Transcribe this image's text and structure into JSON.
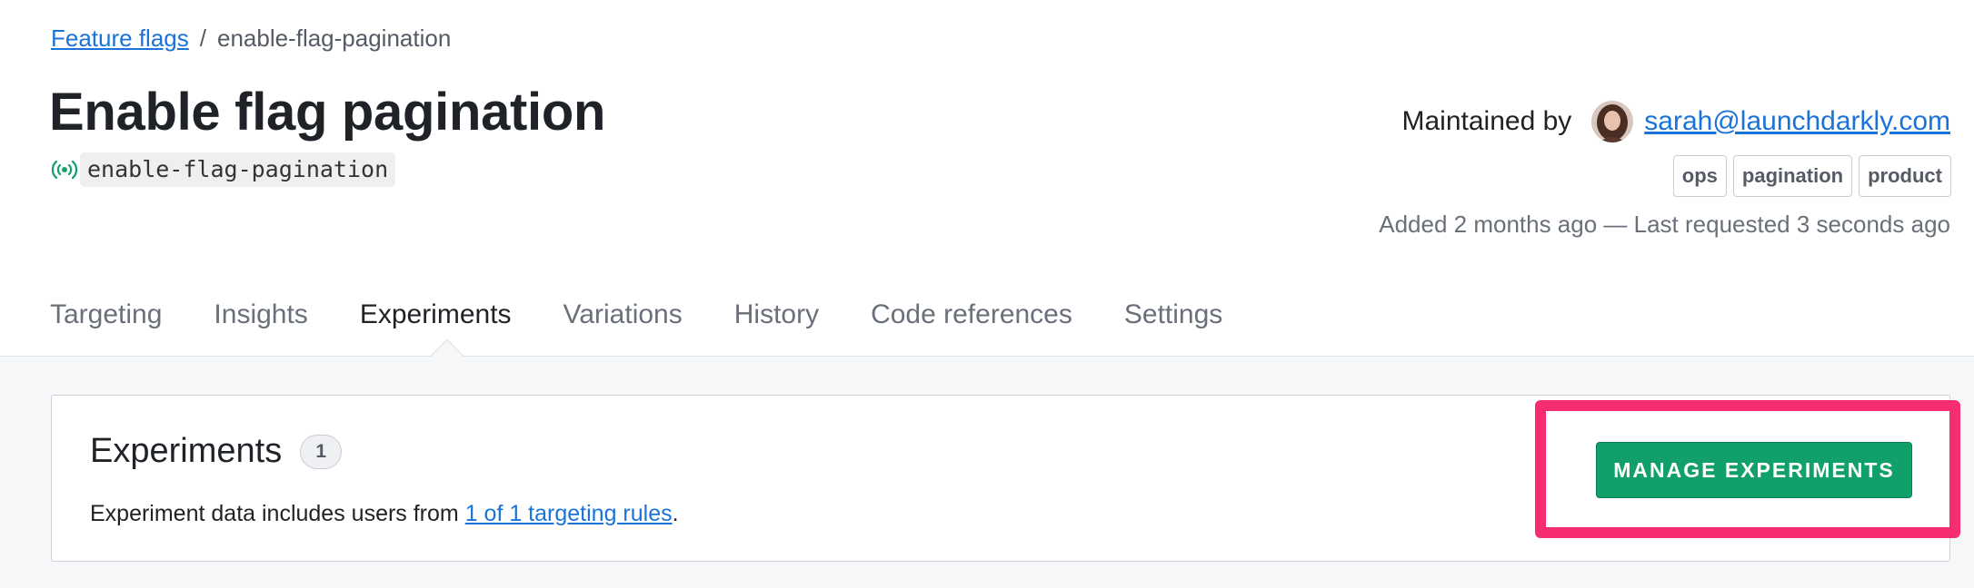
{
  "breadcrumb": {
    "parent": "Feature flags",
    "separator": "/",
    "current": "enable-flag-pagination"
  },
  "flag": {
    "name": "Enable flag pagination",
    "key": "enable-flag-pagination",
    "status_icon": "signal-broadcast-icon"
  },
  "maintainer": {
    "label": "Maintained by",
    "email": "sarah@launchdarkly.com"
  },
  "tags": [
    "ops",
    "pagination",
    "product"
  ],
  "dates_text": "Added 2 months ago — Last requested 3 seconds ago",
  "tabs": [
    {
      "label": "Targeting",
      "active": false
    },
    {
      "label": "Insights",
      "active": false
    },
    {
      "label": "Experiments",
      "active": true
    },
    {
      "label": "Variations",
      "active": false
    },
    {
      "label": "History",
      "active": false
    },
    {
      "label": "Code references",
      "active": false
    },
    {
      "label": "Settings",
      "active": false
    }
  ],
  "experiments": {
    "title": "Experiments",
    "count": "1",
    "description_prefix": "Experiment data includes users from ",
    "description_link": "1 of 1 targeting rules",
    "description_suffix": ".",
    "manage_button": "MANAGE EXPERIMENTS"
  },
  "colors": {
    "link": "#1a73d9",
    "button_green": "#12a06a",
    "highlight": "#f72d72",
    "signal_icon": "#12a06a"
  }
}
